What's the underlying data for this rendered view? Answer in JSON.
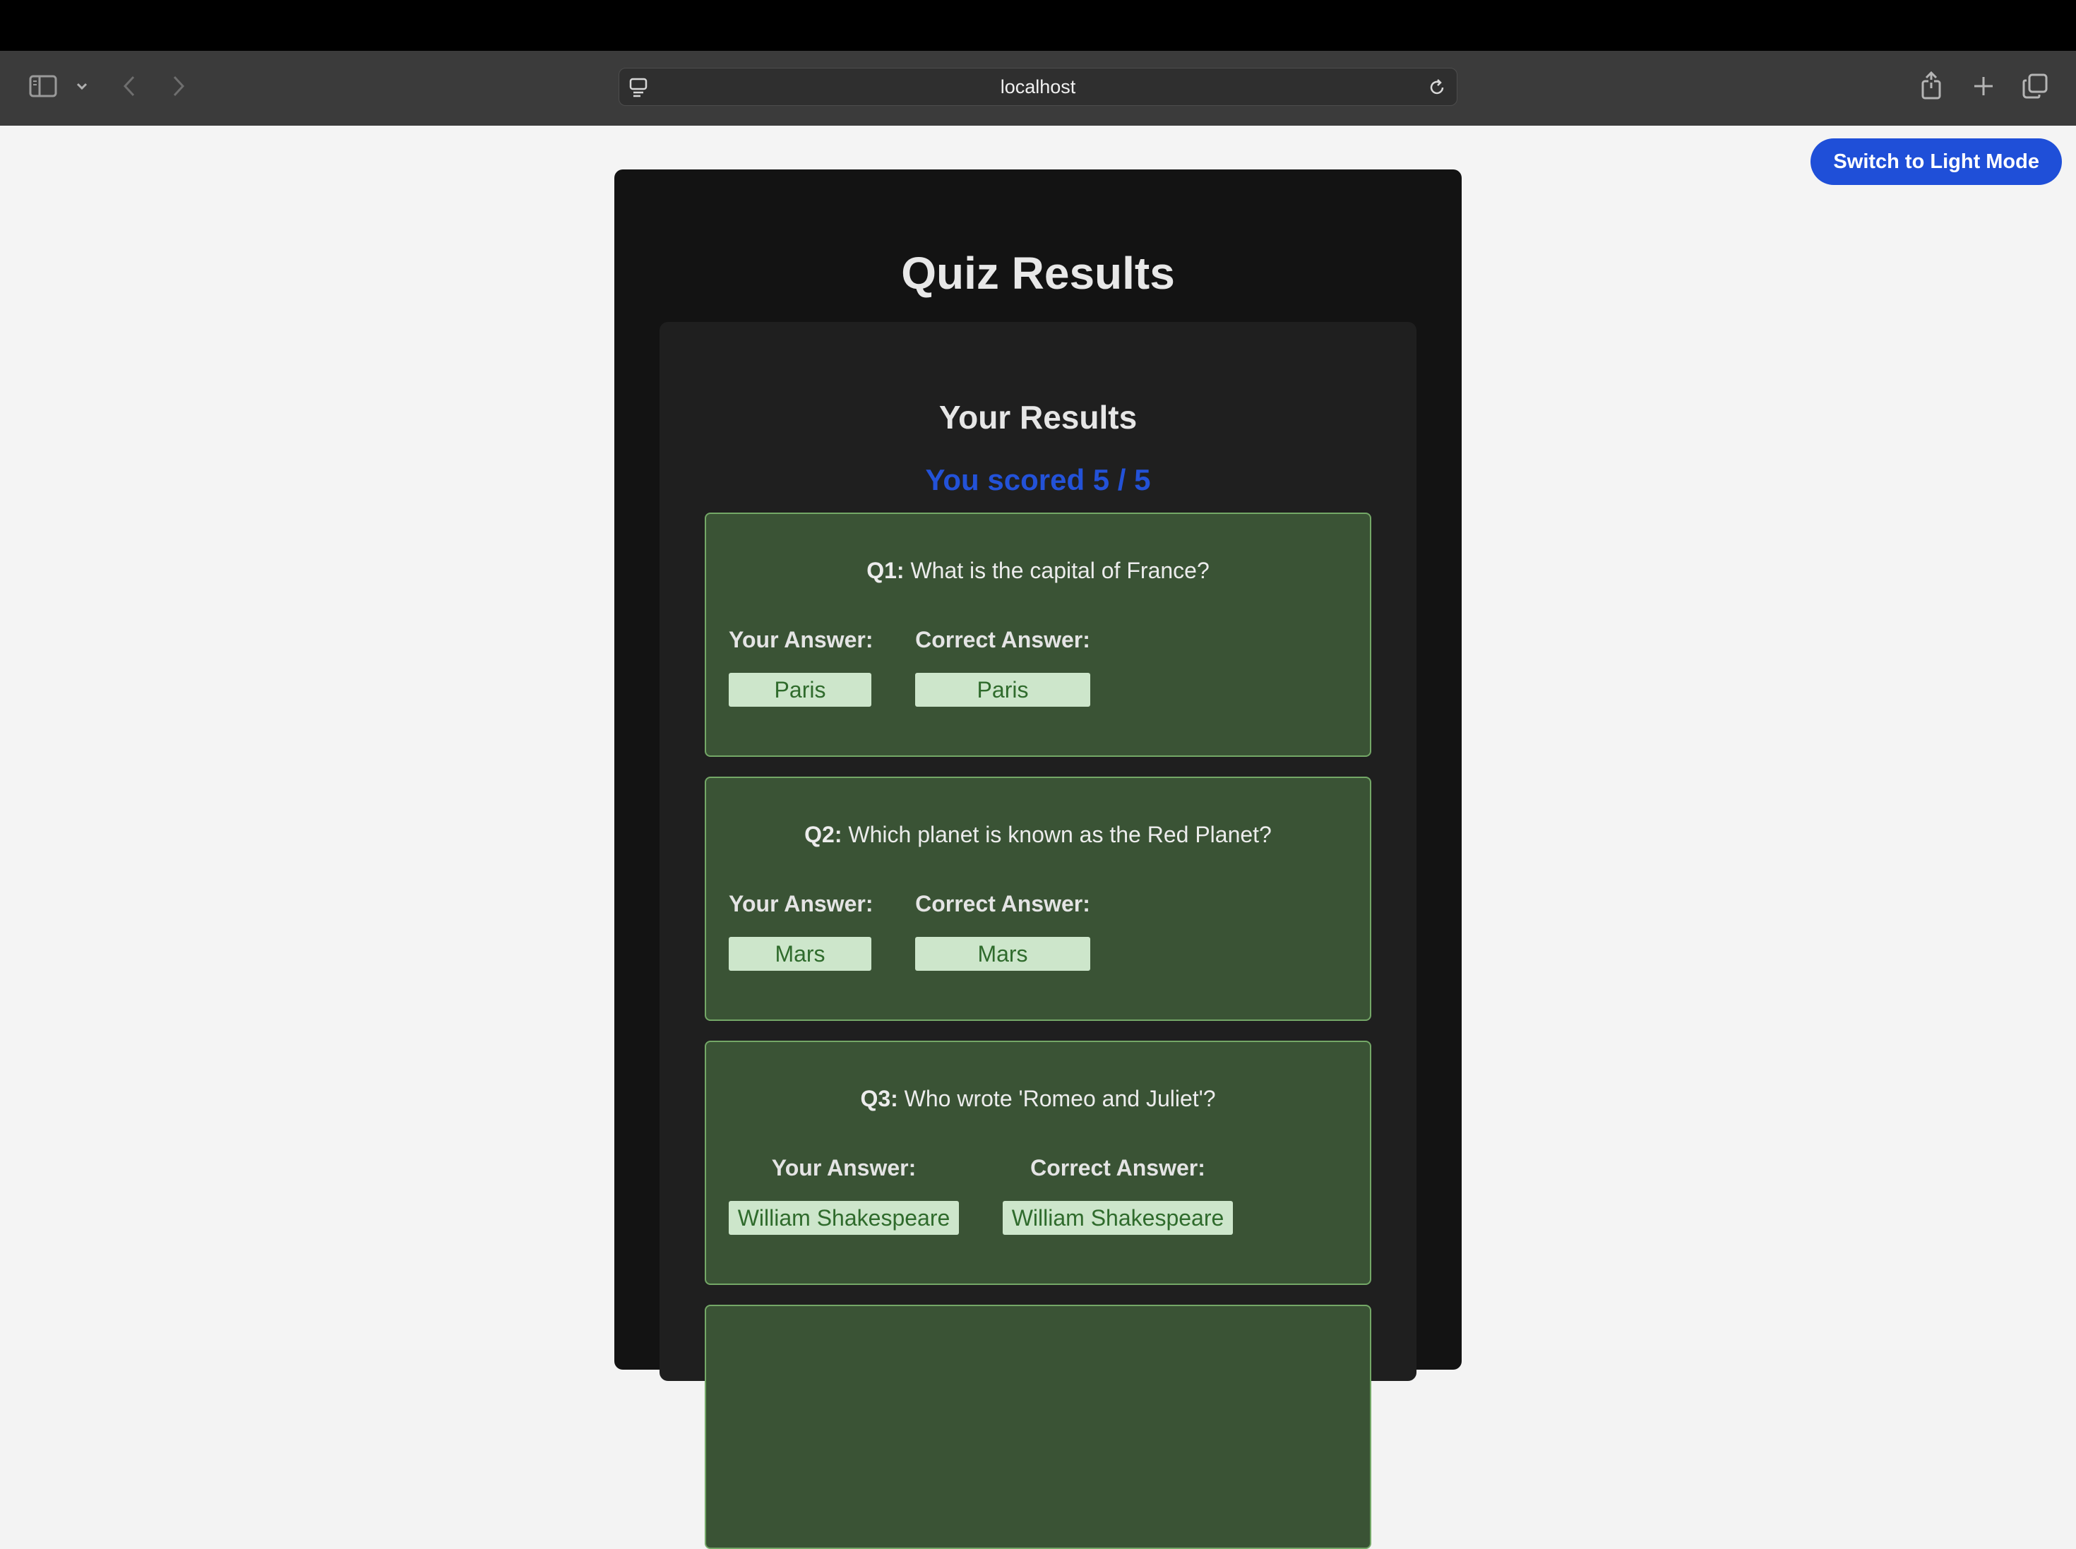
{
  "browser": {
    "url": "localhost"
  },
  "page": {
    "theme_button": "Switch to Light Mode",
    "title": "Quiz Results",
    "results_heading": "Your Results",
    "score_text": "You scored 5 / 5",
    "your_answer_label": "Your Answer:",
    "correct_answer_label": "Correct Answer:",
    "questions": [
      {
        "num": "Q1:",
        "text": "What is the capital of France?",
        "your_answer": "Paris",
        "correct_answer": "Paris"
      },
      {
        "num": "Q2:",
        "text": "Which planet is known as the Red Planet?",
        "your_answer": "Mars",
        "correct_answer": "Mars"
      },
      {
        "num": "Q3:",
        "text": "Who wrote 'Romeo and Juliet'?",
        "your_answer": "William Shakespeare",
        "correct_answer": "William Shakespeare"
      }
    ]
  },
  "colors": {
    "accent": "#1f4fd8",
    "correct_card": "#3a5335",
    "correct_border": "#74a867",
    "answer_chip": "#cde6cb"
  }
}
